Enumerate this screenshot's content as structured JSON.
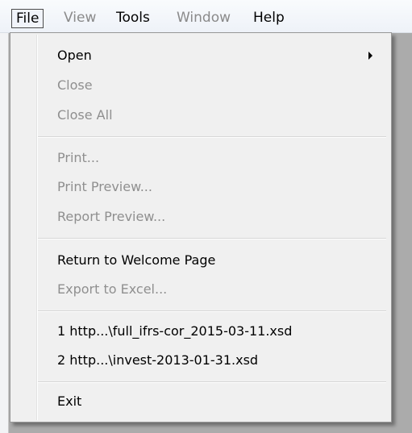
{
  "menubar": {
    "file": "File",
    "view": "View",
    "tools": "Tools",
    "window": "Window",
    "help": "Help"
  },
  "file_menu": {
    "open": "Open",
    "close": "Close",
    "close_all": "Close All",
    "print": "Print...",
    "print_preview": "Print Preview...",
    "report_preview": "Report Preview...",
    "return_welcome": "Return to Welcome Page",
    "export_excel": "Export to Excel...",
    "recent_1": "1 http...\\full_ifrs-cor_2015-03-11.xsd",
    "recent_2": "2 http...\\invest-2013-01-31.xsd",
    "exit": "Exit"
  }
}
